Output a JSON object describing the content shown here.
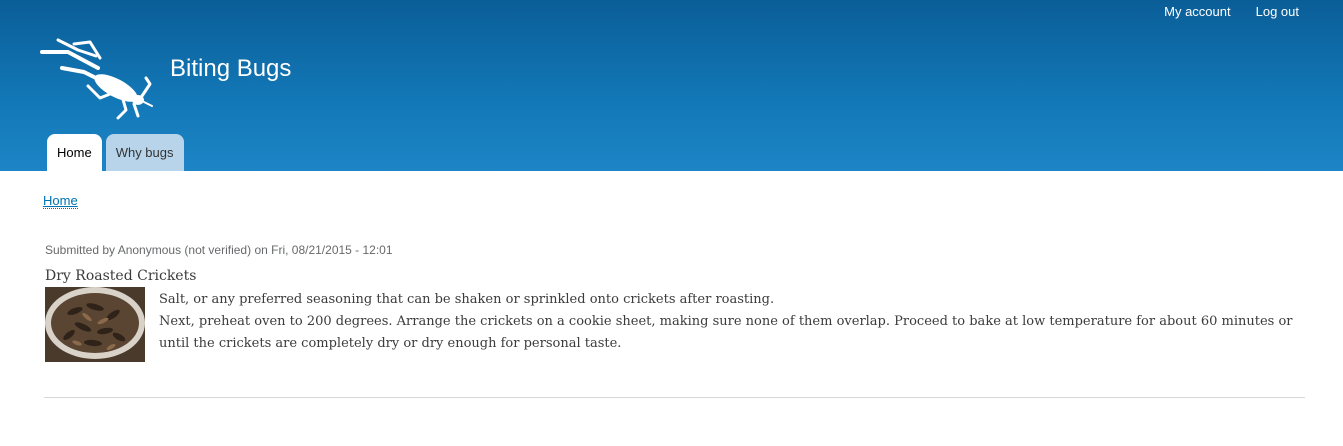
{
  "header": {
    "site_name": "Biting Bugs",
    "secondary_menu": [
      "My account",
      "Log out"
    ],
    "tabs": [
      {
        "label": "Home",
        "active": true
      },
      {
        "label": "Why bugs",
        "active": false
      }
    ],
    "colors": {
      "header_top": "#0a5e98",
      "header_bottom": "#1d85c6",
      "inactive_tab": "#b7d4ea"
    }
  },
  "breadcrumb": "Home",
  "node": {
    "submitted": "Submitted by Anonymous (not verified) on Fri, 08/21/2015 - 12:01",
    "title": "Dry Roasted Crickets",
    "paragraphs": [
      "Salt, or any preferred seasoning that can be shaken or sprinkled onto crickets after roasting.",
      "Next, preheat oven to 200 degrees. Arrange the crickets on a cookie sheet, making sure none of them overlap. Proceed to bake at low temperature for about 60 minutes or until the crickets are completely dry or dry enough for personal taste."
    ]
  }
}
